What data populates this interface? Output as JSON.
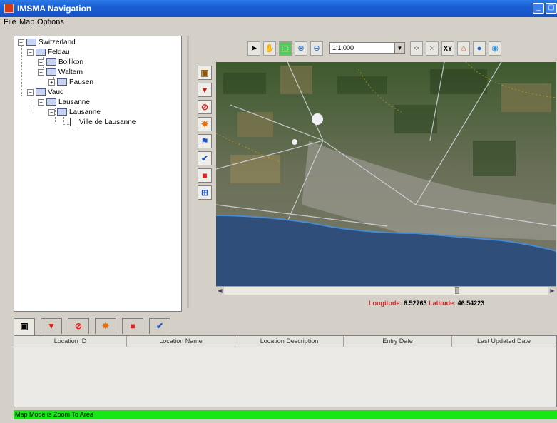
{
  "window": {
    "title": "IMSMA Navigation"
  },
  "menu": {
    "items": [
      "File",
      "Map",
      "Options"
    ]
  },
  "tree": {
    "nodes": [
      {
        "label": "Switzerland"
      },
      {
        "label": "Feldau"
      },
      {
        "label": "Bollikon"
      },
      {
        "label": "Waltern"
      },
      {
        "label": "Pausen"
      },
      {
        "label": "Vaud"
      },
      {
        "label": "Lausanne"
      },
      {
        "label": "Lausanne"
      },
      {
        "label": "Ville de Lausanne"
      }
    ]
  },
  "toolbar": {
    "scale_value": "1:1,000",
    "icons": [
      "pointer-icon",
      "pan-hand-icon",
      "zoom-area-icon",
      "zoom-in-icon",
      "zoom-out-icon",
      "full-extent-icon",
      "zoom-previous-icon",
      "xy-icon",
      "home-icon",
      "globe-icon",
      "refresh-globe-icon"
    ],
    "xy_label": "XY"
  },
  "side_tools": [
    "location-icon",
    "danger-area-icon",
    "forbidden-icon",
    "explosion-icon",
    "flag-icon",
    "check-icon",
    "minefield-icon",
    "network-icon"
  ],
  "coordinates": {
    "longitude_label": "Longitude:",
    "longitude_value": "6.52763",
    "latitude_label": "Latitude:",
    "latitude_value": "46.54223"
  },
  "bottom_tabs": [
    "location-tab-icon",
    "danger-tab-icon",
    "forbidden-tab-icon",
    "explosion-tab-icon",
    "minefield-tab-icon",
    "check-tab-icon"
  ],
  "table": {
    "columns": [
      "Location ID",
      "Location Name",
      "Location Description",
      "Entry Date",
      "Last Updated Date"
    ],
    "rows": []
  },
  "status": {
    "text": "Map Mode is Zoom To Area"
  },
  "colors": {
    "title_bar": "#1a5ed4",
    "status_bar": "#17e617",
    "coord_label": "#e02020"
  }
}
